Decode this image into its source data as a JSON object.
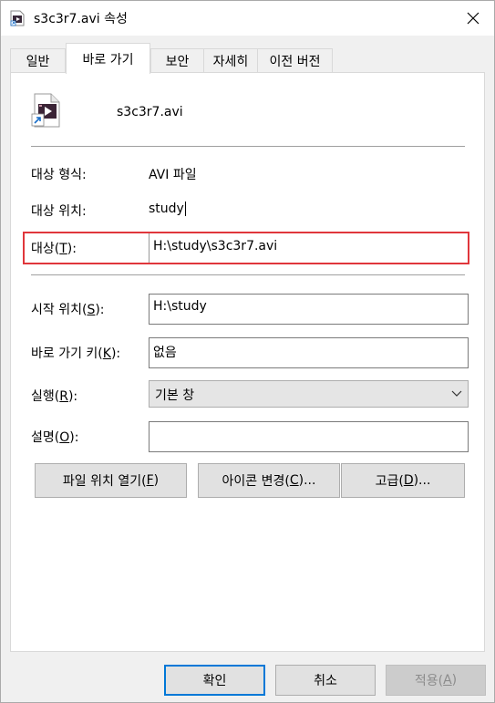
{
  "window": {
    "title": "s3c3r7.avi 속성",
    "close_icon": "close-icon"
  },
  "tabs": [
    {
      "label": "일반"
    },
    {
      "label": "바로 가기"
    },
    {
      "label": "보안"
    },
    {
      "label": "자세히"
    },
    {
      "label": "이전 버전"
    }
  ],
  "file": {
    "name": "s3c3r7.avi",
    "icon": "video-shortcut-icon"
  },
  "rows": {
    "target_type_label": "대상 형식:",
    "target_type_value": "AVI 파일",
    "target_location_label": "대상 위치:",
    "target_location_value": "study",
    "target_label_pre": "대상(",
    "target_label_key": "T",
    "target_label_post": "):",
    "target_value": "H:\\study\\s3c3r7.avi",
    "start_in_label_pre": "시작 위치(",
    "start_in_label_key": "S",
    "start_in_label_post": "):",
    "start_in_value": "H:\\study",
    "shortcut_key_label_pre": "바로 가기 키(",
    "shortcut_key_label_key": "K",
    "shortcut_key_label_post": "):",
    "shortcut_key_value": "없음",
    "run_label_pre": "실행(",
    "run_label_key": "R",
    "run_label_post": "):",
    "run_value": "기본 창",
    "comment_label_pre": "설명(",
    "comment_label_key": "O",
    "comment_label_post": "):",
    "comment_value": ""
  },
  "buttons": {
    "open_location_pre": "파일 위치 열기(",
    "open_location_key": "F",
    "open_location_post": ")",
    "change_icon_pre": "아이콘 변경(",
    "change_icon_key": "C",
    "change_icon_post": ")...",
    "advanced_pre": "고급(",
    "advanced_key": "D",
    "advanced_post": ")...",
    "ok": "확인",
    "cancel": "취소",
    "apply_pre": "적용(",
    "apply_key": "A",
    "apply_post": ")"
  }
}
